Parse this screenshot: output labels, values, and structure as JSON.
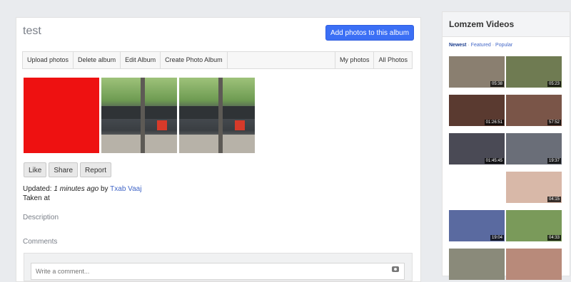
{
  "album": {
    "title": "test",
    "add_photos_label": "Add photos to this album"
  },
  "toolbar": {
    "left_items": [
      "Upload photos",
      "Delete album",
      "Edit Album",
      "Create Photo Album"
    ],
    "right_items": [
      "My photos",
      "All Photos"
    ]
  },
  "photos": [
    {
      "kind": "red-image",
      "color": "#ee1111"
    },
    {
      "kind": "kitchen-scene"
    },
    {
      "kind": "kitchen-scene"
    }
  ],
  "actions": {
    "like": "Like",
    "share": "Share",
    "report": "Report"
  },
  "meta": {
    "updated_prefix": "Updated:",
    "updated_time": "1 minutes ago",
    "by": "by",
    "author": "Txab Vaaj",
    "taken_at": "Taken at"
  },
  "sections": {
    "description": "Description",
    "comments": "Comments"
  },
  "comment": {
    "placeholder": "Write a comment..."
  },
  "sidebar": {
    "title": "Lomzem Videos",
    "filters": [
      "Newest",
      "Featured",
      "Popular"
    ],
    "active_filter": "Newest",
    "videos": [
      {
        "duration": "05:38",
        "color": "#8a7f70"
      },
      {
        "duration": "05:23",
        "color": "#6f7b52"
      },
      {
        "duration": "01:26:51",
        "color": "#5a3a30"
      },
      {
        "duration": "57:52",
        "color": "#7a5548"
      },
      {
        "duration": "01:45:45",
        "color": "#4a4a55"
      },
      {
        "duration": "19:37",
        "color": "#6a6e78"
      },
      {
        "duration": "",
        "color": "#ffffff"
      },
      {
        "duration": "04:15",
        "color": "#d8b8a8"
      },
      {
        "duration": "19:04",
        "color": "#5a6aa0"
      },
      {
        "duration": "04:33",
        "color": "#7a9a5a"
      },
      {
        "duration": "",
        "color": "#8a8a7a"
      },
      {
        "duration": "",
        "color": "#b88a7a"
      }
    ]
  }
}
